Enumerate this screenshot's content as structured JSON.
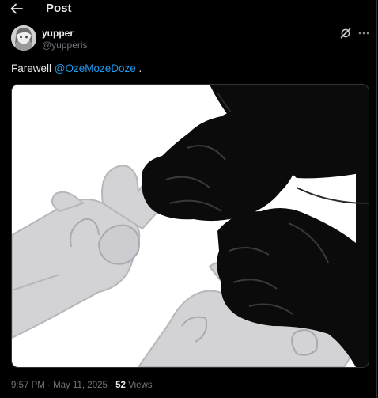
{
  "header": {
    "title": "Post",
    "back_icon": "arrow-left-icon"
  },
  "author": {
    "display_name": "yupper",
    "handle": "@yupperis",
    "avatar_icon": "avatar-image"
  },
  "actions": {
    "grok_icon": "grok-icon",
    "more_icon": "more-horizontal-icon"
  },
  "tweet": {
    "text_before": "Farewell ",
    "mention": "@OzeMozeDoze",
    "text_after": " ."
  },
  "media": {
    "description_icon": "drawing-image"
  },
  "meta": {
    "time": "9:57 PM",
    "separator1": " · ",
    "date": "May 11, 2025",
    "separator2": " · ",
    "views_count": "52",
    "views_label": " Views"
  },
  "colors": {
    "background": "#000000",
    "text": "#e7e9ea",
    "muted": "#71767b",
    "link": "#1d9bf0",
    "border": "#2f3336"
  }
}
